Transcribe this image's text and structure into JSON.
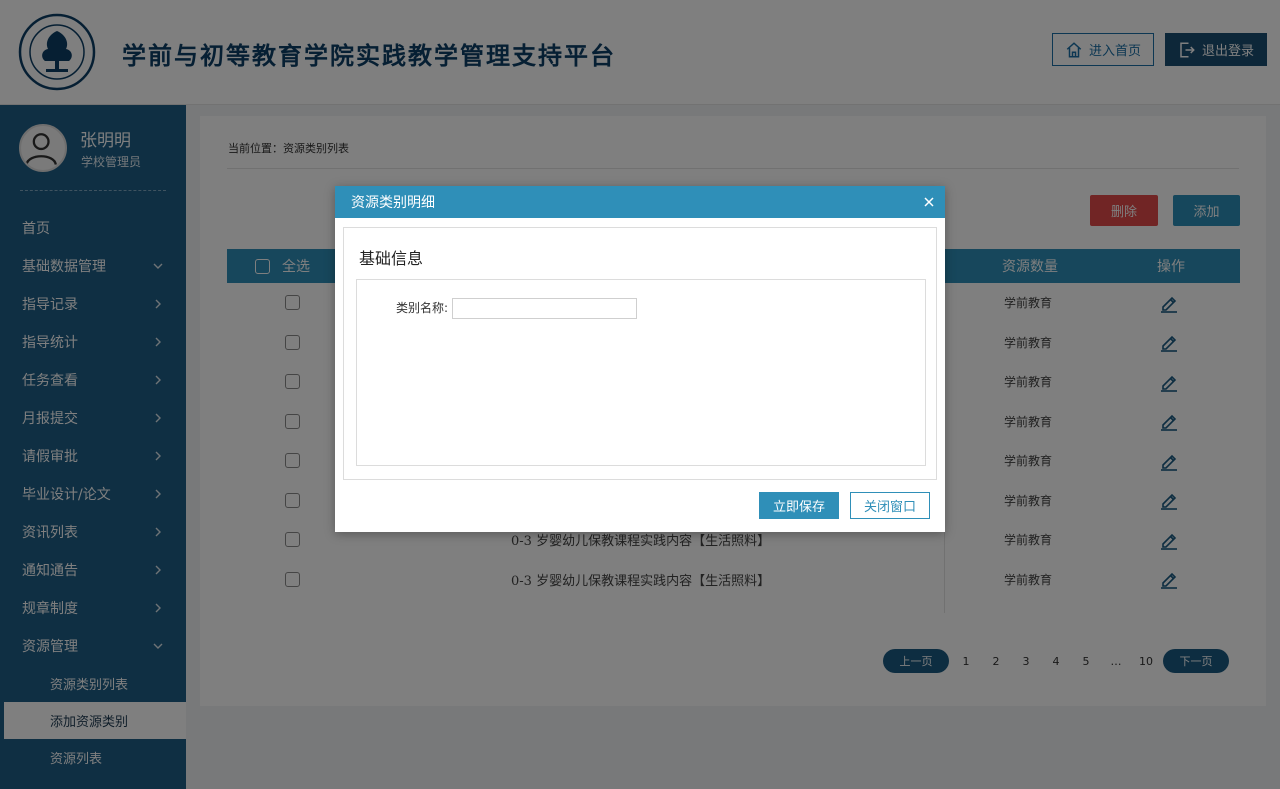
{
  "header": {
    "title": "学前与初等教育学院实践教学管理支持平台",
    "home_label": "进入首页",
    "logout_label": "退出登录",
    "logo_text": "SHENYANG NORMAL UNIVERSITY 1951"
  },
  "user": {
    "name": "张明明",
    "role": "学校管理员"
  },
  "sidebar": {
    "items": [
      {
        "label": "首页"
      },
      {
        "label": "基础数据管理"
      },
      {
        "label": "指导记录"
      },
      {
        "label": "指导统计"
      },
      {
        "label": "任务查看"
      },
      {
        "label": "月报提交"
      },
      {
        "label": "请假审批"
      },
      {
        "label": "毕业设计/论文"
      },
      {
        "label": "资讯列表"
      },
      {
        "label": "通知通告"
      },
      {
        "label": "规章制度"
      },
      {
        "label": "资源管理"
      }
    ],
    "sub_items": [
      {
        "label": "资源类别列表"
      },
      {
        "label": "添加资源类别"
      },
      {
        "label": "资源列表"
      }
    ]
  },
  "content": {
    "breadcrumb": "当前位置：资源类别列表",
    "delete_label": "删除",
    "add_label": "添加"
  },
  "table": {
    "headers": {
      "select_all": "全选",
      "count": "资源数量",
      "action": "操作"
    },
    "rows": [
      {
        "name": "",
        "count": "学前教育"
      },
      {
        "name": "",
        "count": "学前教育"
      },
      {
        "name": "",
        "count": "学前教育"
      },
      {
        "name": "",
        "count": "学前教育"
      },
      {
        "name": "",
        "count": "学前教育"
      },
      {
        "name": "",
        "count": "学前教育"
      },
      {
        "name": "0-3 岁婴幼儿保教课程实践内容【生活照料】",
        "count": "学前教育"
      },
      {
        "name": "0-3 岁婴幼儿保教课程实践内容【生活照料】",
        "count": "学前教育"
      }
    ]
  },
  "pagination": {
    "prev_label": "上一页",
    "next_label": "下一页",
    "pages": [
      "1",
      "2",
      "3",
      "4",
      "5",
      "…",
      "10"
    ]
  },
  "modal": {
    "title": "资源类别明细",
    "section_title": "基础信息",
    "field_label": "类别名称:",
    "field_value": "",
    "field_placeholder": "",
    "save_label": "立即保存",
    "close_label": "关闭窗口"
  },
  "colors": {
    "primary": "#2f8fb8",
    "sidebar": "#1e5f87",
    "title": "#0d3f66",
    "danger": "#e24b4b"
  }
}
